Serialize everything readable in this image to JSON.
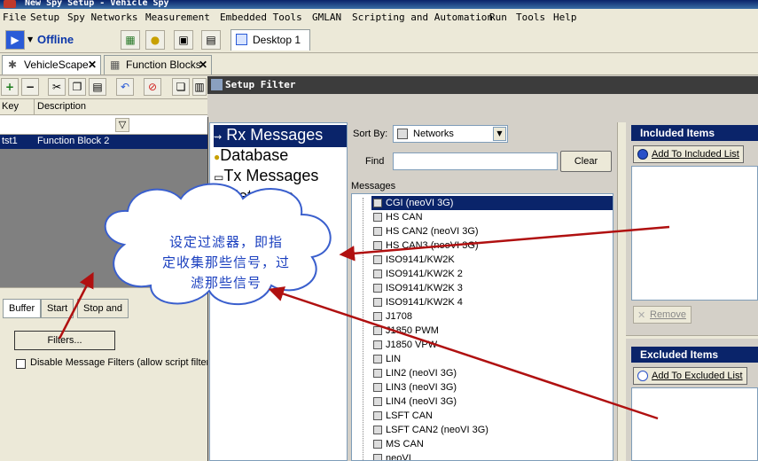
{
  "window": {
    "title": "New Spy Setup - Vehicle Spy"
  },
  "menubar": {
    "items": [
      "File",
      "Setup",
      "Spy Networks",
      "Measurement",
      "Embedded Tools",
      "GMLAN",
      "Scripting and Automation",
      "Run",
      "Tools",
      "Help"
    ]
  },
  "toolbar": {
    "status": "Offline",
    "desktop_tab": "Desktop 1"
  },
  "doc_tabs": [
    "VehicleScape",
    "Function Blocks"
  ],
  "function_blocks": {
    "columns": [
      "Key",
      "Description"
    ],
    "rows": [
      {
        "key": "tst1",
        "description": "Function Block 2"
      }
    ]
  },
  "bottom_tabs": [
    "Buffer",
    "Start",
    "Stop and"
  ],
  "filters_button": "Filters...",
  "disable_filters_label": "Disable Message Filters (allow script filter",
  "dialog": {
    "title": "Setup Filter",
    "categories": [
      "Rx Messages",
      "Database",
      "Tx Messages",
      "Networks"
    ],
    "selected_category": "Rx Messages",
    "sort_label": "Sort By:",
    "sort_value": "Networks",
    "find_label": "Find",
    "find_value": "",
    "clear_label": "Clear",
    "messages_label": "Messages",
    "messages": [
      "CGI (neoVI 3G)",
      "HS CAN",
      "HS CAN2 (neoVI 3G)",
      "HS CAN3 (neoVI 3G)",
      "ISO9141/KW2K",
      "ISO9141/KW2K 2",
      "ISO9141/KW2K 3",
      "ISO9141/KW2K 4",
      "J1708",
      "J1850 PWM",
      "J1850 VPW",
      "LIN",
      "LIN2 (neoVI 3G)",
      "LIN3 (neoVI 3G)",
      "LIN4 (neoVI 3G)",
      "LSFT CAN",
      "LSFT CAN2 (neoVI 3G)",
      "MS CAN",
      "neoVI"
    ],
    "selected_message": "CGI (neoVI 3G)",
    "included_header": "Included Items",
    "add_included": "Add To Included List",
    "remove_label": "Remove",
    "excluded_header": "Excluded Items",
    "add_excluded": "Add To Excluded List"
  },
  "annotation": {
    "callout_line1": "设定过滤器，即指",
    "callout_line2": "定收集那些信号，过",
    "callout_line3": "滤那些信号",
    "arrow_color": "#b01010",
    "text_color": "#1a3fbf"
  },
  "colors": {
    "selection": "#0a246a",
    "panel": "#d4d0c8"
  }
}
